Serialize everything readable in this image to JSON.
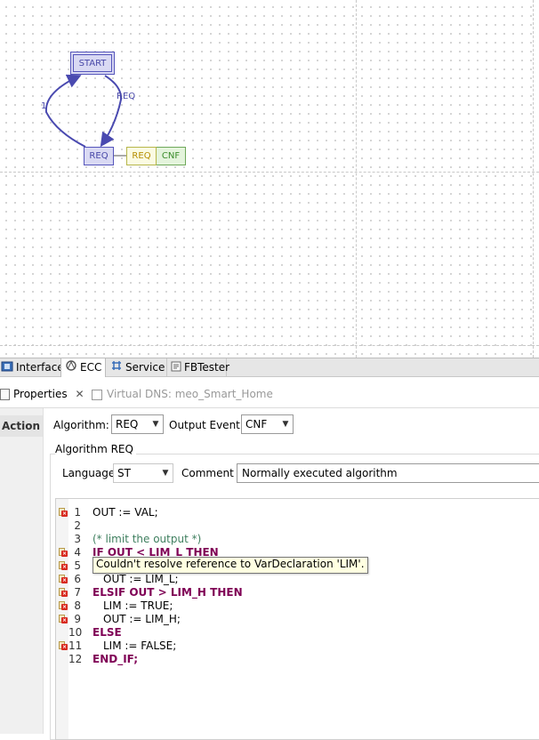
{
  "ecc": {
    "start_state": "START",
    "req_state": "REQ",
    "action_algorithm": "REQ",
    "action_event": "CNF",
    "transition_start_to_req": "REQ",
    "transition_req_to_start": "1"
  },
  "editor_tabs": [
    "Interface",
    "ECC",
    "Service",
    "FBTester"
  ],
  "view_tabs": {
    "properties": "Properties",
    "virtual_dns": "Virtual DNS: meo_Smart_Home"
  },
  "properties": {
    "sidebar_tab": "Action",
    "algorithm_label": "Algorithm:",
    "algorithm_value": "REQ",
    "output_event_label": "Output Event:",
    "output_event_value": "CNF",
    "group_title": "Algorithm REQ",
    "language_label": "Language",
    "language_value": "ST",
    "comment_label": "Comment",
    "comment_value": "Normally executed algorithm"
  },
  "code": {
    "lines": [
      {
        "num": "1",
        "text": "OUT := VAL;",
        "style": "plain",
        "error": true
      },
      {
        "num": "2",
        "text": "",
        "style": "plain",
        "error": false
      },
      {
        "num": "3",
        "text": "(* limit the output *)",
        "style": "comment",
        "error": false
      },
      {
        "num": "4",
        "text": "IF OUT < LIM_L THEN",
        "style": "keyword",
        "error": true
      },
      {
        "num": "5",
        "text": "",
        "style": "plain",
        "error": true
      },
      {
        "num": "6",
        "text": "OUT := LIM_L;",
        "style": "plain-indent",
        "error": true
      },
      {
        "num": "7",
        "text": "ELSIF OUT > LIM_H THEN",
        "style": "keyword",
        "error": true
      },
      {
        "num": "8",
        "text": "LIM := TRUE;",
        "style": "plain-indent",
        "error": true
      },
      {
        "num": "9",
        "text": "OUT := LIM_H;",
        "style": "plain-indent",
        "error": true
      },
      {
        "num": "10",
        "text": "ELSE",
        "style": "keyword",
        "error": false
      },
      {
        "num": "11",
        "text": "LIM := FALSE;",
        "style": "plain-indent",
        "error": true
      },
      {
        "num": "12",
        "text": "END_IF;",
        "style": "keyword",
        "error": false
      }
    ],
    "tooltip": "Couldn't resolve reference to VarDeclaration 'LIM'."
  }
}
